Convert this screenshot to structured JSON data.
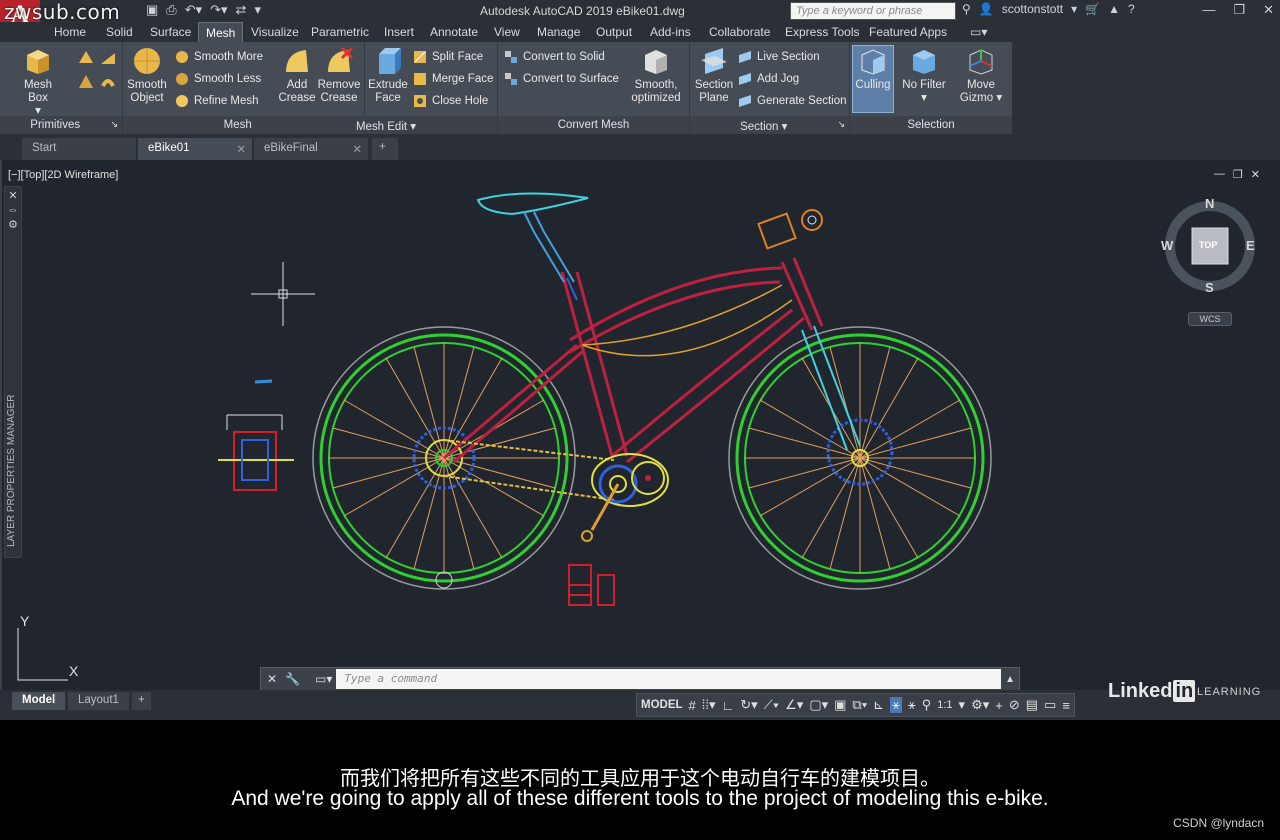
{
  "watermark": "zwsub.com",
  "app": {
    "logo": "A",
    "title": "Autodesk AutoCAD 2019  eBike01.dwg",
    "search_placeholder": "Type a keyword or phrase",
    "user": "scottonstott"
  },
  "ribbon_tabs": [
    "Home",
    "Solid",
    "Surface",
    "Mesh",
    "Visualize",
    "Parametric",
    "Insert",
    "Annotate",
    "View",
    "Manage",
    "Output",
    "Add-ins",
    "Collaborate",
    "Express Tools",
    "Featured Apps"
  ],
  "active_ribbon_tab": "Mesh",
  "panels": {
    "primitives": {
      "title": "Primitives",
      "mesh_box": "Mesh Box"
    },
    "mesh": {
      "title": "Mesh",
      "smooth_object": "Smooth Object",
      "smooth_more": "Smooth More",
      "smooth_less": "Smooth Less",
      "refine_mesh": "Refine Mesh"
    },
    "mesh_edit": {
      "title": "Mesh Edit",
      "add_crease": "Add Crease",
      "remove_crease": "Remove Crease",
      "extrude_face": "Extrude Face",
      "split_face": "Split Face",
      "merge_face": "Merge Face",
      "close_hole": "Close Hole"
    },
    "convert_mesh": {
      "title": "Convert Mesh",
      "convert_solid": "Convert to Solid",
      "convert_surface": "Convert to Surface",
      "smooth_optimized": "Smooth, optimized"
    },
    "section": {
      "title": "Section",
      "section_plane": "Section Plane",
      "live_section": "Live Section",
      "add_jog": "Add Jog",
      "generate_section": "Generate Section"
    },
    "selection": {
      "title": "Selection",
      "culling": "Culling",
      "no_filter": "No Filter",
      "move_gizmo": "Move Gizmo"
    }
  },
  "file_tabs": [
    "Start",
    "eBike01",
    "eBikeFinal"
  ],
  "active_file_tab": "eBike01",
  "viewport_label": "[−][Top][2D Wireframe]",
  "left_palette": "LAYER PROPERTIES MANAGER",
  "viewcube": {
    "n": "N",
    "s": "S",
    "e": "E",
    "w": "W",
    "face": "TOP",
    "wcs": "WCS"
  },
  "ucs": {
    "x": "X",
    "y": "Y"
  },
  "command": {
    "placeholder": "Type a command"
  },
  "layout_tabs": [
    "Model",
    "Layout1"
  ],
  "status": {
    "model": "MODEL",
    "scale": "1:1"
  },
  "brand": {
    "linkedin": "Linked",
    "in": "in",
    "learning": "LEARNING"
  },
  "subtitles": {
    "cn": "而我们将把所有这些不同的工具应用于这个电动自行车的建模项目。",
    "en": "And we're going to apply all of these different tools to the project of modeling this e-bike."
  },
  "credit": "CSDN @lyndacn"
}
